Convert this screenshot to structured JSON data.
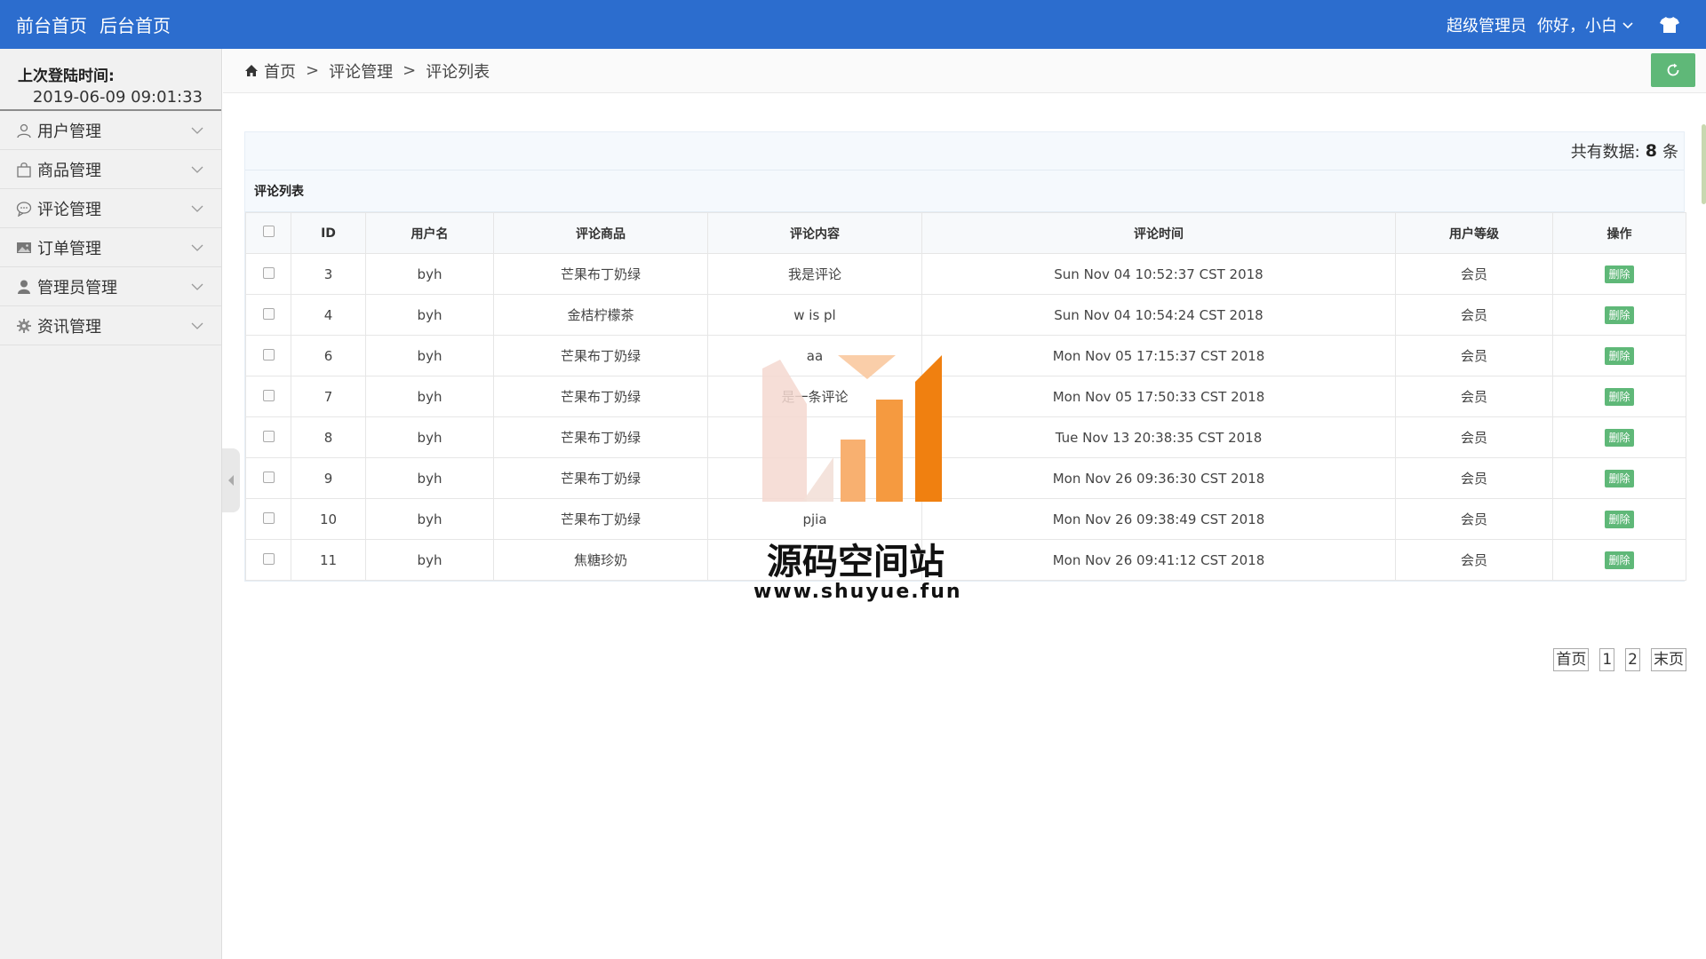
{
  "topbar": {
    "links": [
      "前台首页",
      "后台首页"
    ],
    "role": "超级管理员",
    "greeting": "你好，小白"
  },
  "sidebar": {
    "last_login_label": "上次登陆时间:",
    "last_login_value": "2019-06-09 09:01:33",
    "items": [
      {
        "label": "用户管理",
        "icon": "user-icon"
      },
      {
        "label": "商品管理",
        "icon": "bag-icon"
      },
      {
        "label": "评论管理",
        "icon": "comment-icon"
      },
      {
        "label": "订单管理",
        "icon": "image-icon"
      },
      {
        "label": "管理员管理",
        "icon": "person-icon"
      },
      {
        "label": "资讯管理",
        "icon": "gear-icon"
      }
    ]
  },
  "breadcrumb": {
    "home": "首页",
    "level1": "评论管理",
    "level2": "评论列表"
  },
  "total": {
    "prefix": "共有数据:",
    "count": "8",
    "suffix": "条"
  },
  "table": {
    "caption": "评论列表",
    "headers": [
      "ID",
      "用户名",
      "评论商品",
      "评论内容",
      "评论时间",
      "用户等级",
      "操作"
    ],
    "delete_label": "删除",
    "rows": [
      {
        "id": "3",
        "user": "byh",
        "product": "芒果布丁奶绿",
        "content": "我是评论",
        "time": "Sun Nov 04 10:52:37 CST 2018",
        "level": "会员"
      },
      {
        "id": "4",
        "user": "byh",
        "product": "金桔柠檬茶",
        "content": "w is pl",
        "time": "Sun Nov 04 10:54:24 CST 2018",
        "level": "会员"
      },
      {
        "id": "6",
        "user": "byh",
        "product": "芒果布丁奶绿",
        "content": "aa",
        "time": "Mon Nov 05 17:15:37 CST 2018",
        "level": "会员"
      },
      {
        "id": "7",
        "user": "byh",
        "product": "芒果布丁奶绿",
        "content": "是一条评论",
        "time": "Mon Nov 05 17:50:33 CST 2018",
        "level": "会员"
      },
      {
        "id": "8",
        "user": "byh",
        "product": "芒果布丁奶绿",
        "content": "",
        "time": "Tue Nov 13 20:38:35 CST 2018",
        "level": "会员"
      },
      {
        "id": "9",
        "user": "byh",
        "product": "芒果布丁奶绿",
        "content": "",
        "time": "Mon Nov 26 09:36:30 CST 2018",
        "level": "会员"
      },
      {
        "id": "10",
        "user": "byh",
        "product": "芒果布丁奶绿",
        "content": "pjia",
        "time": "Mon Nov 26 09:38:49 CST 2018",
        "level": "会员"
      },
      {
        "id": "11",
        "user": "byh",
        "product": "焦糖珍奶",
        "content": "",
        "time": "Mon Nov 26 09:41:12 CST 2018",
        "level": "会员"
      }
    ]
  },
  "pager": {
    "first": "首页",
    "pages": [
      "1",
      "2"
    ],
    "last": "末页"
  },
  "watermark": {
    "title": "源码空间站",
    "url": "www.shuyue.fun"
  },
  "colors": {
    "topbar": "#2c6dce",
    "accent_green": "#5fb878",
    "sidebar_bg": "#f1f1f1"
  }
}
